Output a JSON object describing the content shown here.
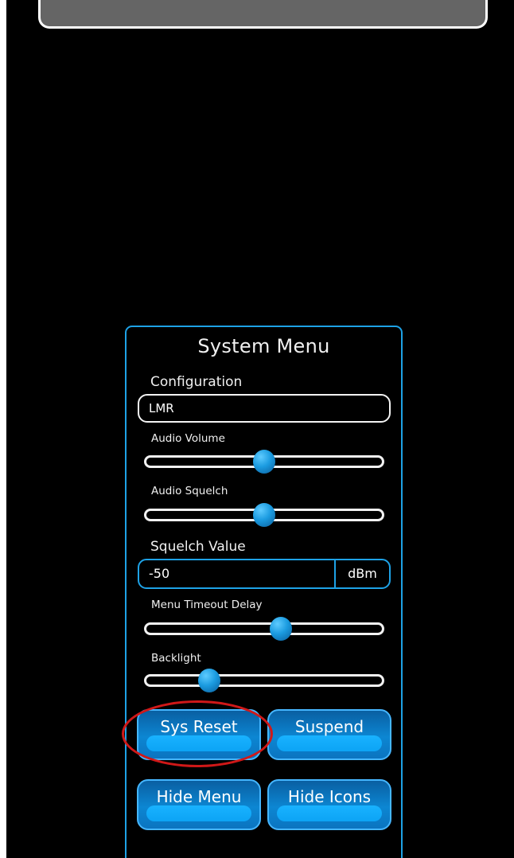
{
  "system_menu": {
    "title": "System Menu",
    "configuration": {
      "label": "Configuration",
      "value": "LMR"
    },
    "audio_volume": {
      "label": "Audio Volume",
      "level": 0.5
    },
    "audio_squelch": {
      "label": "Audio Squelch",
      "level": 0.5
    },
    "squelch_value": {
      "label": "Squelch Value",
      "value": "-50",
      "unit": "dBm"
    },
    "menu_timeout_delay": {
      "label": "Menu Timeout Delay",
      "level": 0.57
    },
    "backlight": {
      "label": "Backlight",
      "level": 0.27
    },
    "buttons": {
      "sys_reset": "Sys Reset",
      "suspend": "Suspend",
      "hide_menu": "Hide Menu",
      "hide_icons": "Hide Icons"
    }
  },
  "colors": {
    "accent": "#1ea2e6",
    "button": "#0c86d2",
    "annotation": "#d01818",
    "background": "#000000"
  }
}
